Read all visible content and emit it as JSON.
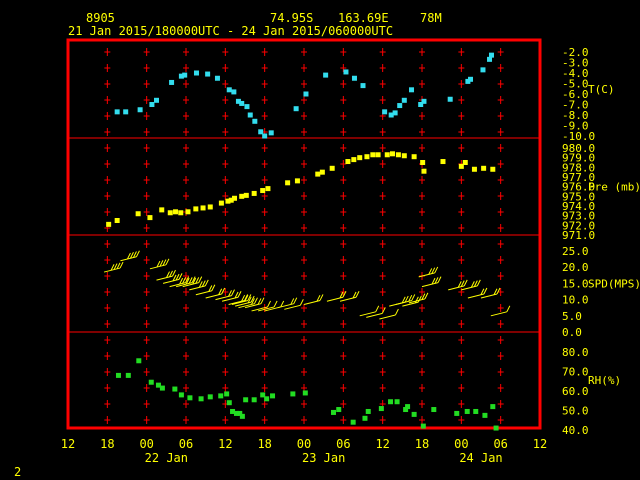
{
  "header": {
    "station": "8905",
    "lat": "74.95S",
    "lon": "163.69E",
    "elev": "78M",
    "period": "21 Jan 2015/180000UTC - 24 Jan 2015/060000UTC"
  },
  "page_number": "2",
  "colors": {
    "frame": "#ff0000",
    "grid_marks": "#ff0000",
    "text": "#ffff00",
    "temperature": "#33ddee",
    "pressure": "#ffff00",
    "wind": "#ffff00",
    "humidity": "#22dd22"
  },
  "chart_data": {
    "type": "scatter",
    "title": "",
    "time_axis": {
      "unit": "hours since 21 Jan 2015 00 UTC",
      "range": [
        12,
        84
      ],
      "ticks": [
        {
          "hour": 12,
          "label": "12"
        },
        {
          "hour": 18,
          "label": "18"
        },
        {
          "hour": 24,
          "label": "00"
        },
        {
          "hour": 30,
          "label": "06"
        },
        {
          "hour": 36,
          "label": "12"
        },
        {
          "hour": 42,
          "label": "18"
        },
        {
          "hour": 48,
          "label": "00"
        },
        {
          "hour": 54,
          "label": "06"
        },
        {
          "hour": 60,
          "label": "12"
        },
        {
          "hour": 66,
          "label": "18"
        },
        {
          "hour": 72,
          "label": "00"
        },
        {
          "hour": 78,
          "label": "06"
        },
        {
          "hour": 84,
          "label": "12"
        }
      ],
      "day_labels": [
        {
          "hour": 27,
          "label": "22 Jan"
        },
        {
          "hour": 51,
          "label": "23 Jan"
        },
        {
          "hour": 75,
          "label": "24 Jan"
        }
      ]
    },
    "panels": [
      {
        "id": "temperature",
        "label": "T(C)",
        "ylim": [
          -10.0,
          -2.0
        ],
        "ticks": [
          "-2.0",
          "-3.0",
          "-4.0",
          "-5.0",
          "-6.0",
          "-7.0",
          "-8.0",
          "-9.0",
          "-10.0"
        ],
        "tick_values": [
          -2,
          -3,
          -4,
          -5,
          -6,
          -7,
          -8,
          -9,
          -10
        ],
        "points": [
          [
            19.5,
            -7.7
          ],
          [
            20.8,
            -7.7
          ],
          [
            23,
            -7.5
          ],
          [
            24.8,
            -7.0
          ],
          [
            25.5,
            -6.6
          ],
          [
            27.8,
            -4.9
          ],
          [
            29.3,
            -4.3
          ],
          [
            29.8,
            -4.2
          ],
          [
            31.6,
            -4.0
          ],
          [
            33.3,
            -4.1
          ],
          [
            34.8,
            -4.5
          ],
          [
            36.6,
            -5.6
          ],
          [
            37.3,
            -5.8
          ],
          [
            38,
            -6.7
          ],
          [
            38.5,
            -6.9
          ],
          [
            39.3,
            -7.2
          ],
          [
            39.8,
            -8.0
          ],
          [
            40.5,
            -8.6
          ],
          [
            41.4,
            -9.6
          ],
          [
            42,
            -10.0
          ],
          [
            43,
            -9.7
          ],
          [
            46.8,
            -7.4
          ],
          [
            48.3,
            -6.0
          ],
          [
            51.3,
            -4.2
          ],
          [
            54.4,
            -3.9
          ],
          [
            55.7,
            -4.5
          ],
          [
            57,
            -5.2
          ],
          [
            60.3,
            -7.7
          ],
          [
            61.3,
            -8.0
          ],
          [
            61.9,
            -7.8
          ],
          [
            62.6,
            -7.1
          ],
          [
            63.3,
            -6.6
          ],
          [
            64.4,
            -5.6
          ],
          [
            65.8,
            -7.0
          ],
          [
            66.3,
            -6.7
          ],
          [
            70.3,
            -6.5
          ],
          [
            73,
            -4.8
          ],
          [
            73.4,
            -4.6
          ],
          [
            75.3,
            -3.7
          ],
          [
            76.3,
            -2.7
          ],
          [
            76.6,
            -2.3
          ]
        ]
      },
      {
        "id": "pressure",
        "label": "Pre (mb)",
        "ylim": [
          971.0,
          980.0
        ],
        "ticks": [
          "980.0",
          "979.0",
          "978.0",
          "977.0",
          "976.0",
          "975.0",
          "974.0",
          "973.0",
          "972.0",
          "971.0"
        ],
        "tick_values": [
          980,
          979,
          978,
          977,
          976,
          975,
          974,
          973,
          972,
          971
        ],
        "points": [
          [
            18.2,
            972.1
          ],
          [
            19.5,
            972.5
          ],
          [
            22.7,
            973.2
          ],
          [
            24.5,
            972.8
          ],
          [
            26.3,
            973.6
          ],
          [
            27.6,
            973.3
          ],
          [
            28.4,
            973.4
          ],
          [
            29.2,
            973.3
          ],
          [
            30.3,
            973.4
          ],
          [
            31.5,
            973.7
          ],
          [
            32.6,
            973.8
          ],
          [
            33.7,
            973.9
          ],
          [
            35.4,
            974.3
          ],
          [
            36.4,
            974.5
          ],
          [
            36.9,
            974.6
          ],
          [
            37.4,
            974.8
          ],
          [
            38.5,
            975.0
          ],
          [
            39.2,
            975.1
          ],
          [
            40.4,
            975.3
          ],
          [
            41.7,
            975.6
          ],
          [
            42.5,
            975.8
          ],
          [
            45.5,
            976.4
          ],
          [
            47,
            976.6
          ],
          [
            50.1,
            977.3
          ],
          [
            50.8,
            977.5
          ],
          [
            52.3,
            977.9
          ],
          [
            54.7,
            978.6
          ],
          [
            55.6,
            978.8
          ],
          [
            56.5,
            979.0
          ],
          [
            57.6,
            979.1
          ],
          [
            58.5,
            979.3
          ],
          [
            59.3,
            979.3
          ],
          [
            60.7,
            979.3
          ],
          [
            61.5,
            979.4
          ],
          [
            62.4,
            979.3
          ],
          [
            63.3,
            979.2
          ],
          [
            64.8,
            979.1
          ],
          [
            66.1,
            978.5
          ],
          [
            66.3,
            977.6
          ],
          [
            69.2,
            978.6
          ],
          [
            72,
            978.1
          ],
          [
            72.6,
            978.5
          ],
          [
            74,
            977.8
          ],
          [
            75.4,
            977.9
          ],
          [
            76.8,
            977.8
          ]
        ]
      },
      {
        "id": "wind",
        "label": "SPD(MPS)",
        "ylim": [
          0.0,
          25.0
        ],
        "ticks": [
          "25.0",
          "20.0",
          "15.0",
          "10.0",
          "5.0",
          "0.0"
        ],
        "tick_values": [
          25,
          20,
          15,
          10,
          5,
          0
        ],
        "barbs": [
          [
            17.5,
            18.5
          ],
          [
            20,
            22
          ],
          [
            24.5,
            19.5
          ],
          [
            25.5,
            16
          ],
          [
            26.5,
            15
          ],
          [
            27.5,
            14
          ],
          [
            28.5,
            14
          ],
          [
            29.5,
            14
          ],
          [
            30.5,
            13
          ],
          [
            31.5,
            11.5
          ],
          [
            33,
            10.5
          ],
          [
            34.5,
            10
          ],
          [
            35.5,
            9.5
          ],
          [
            36.5,
            8.5
          ],
          [
            37,
            8.5
          ],
          [
            37.5,
            8
          ],
          [
            38,
            7.5
          ],
          [
            39,
            7.5
          ],
          [
            40,
            6.5
          ],
          [
            41,
            6.5
          ],
          [
            42,
            6.5
          ],
          [
            44,
            7.5
          ],
          [
            45,
            7
          ],
          [
            48,
            8.5
          ],
          [
            51.5,
            9.5
          ],
          [
            53.5,
            9.5
          ],
          [
            56.5,
            5
          ],
          [
            57.5,
            4.5
          ],
          [
            59.5,
            4
          ],
          [
            61,
            8
          ],
          [
            62,
            8.5
          ],
          [
            63,
            8
          ],
          [
            64,
            9
          ],
          [
            66,
            14
          ],
          [
            65.5,
            17
          ],
          [
            70,
            13
          ],
          [
            72,
            13
          ],
          [
            73,
            10.5
          ],
          [
            75,
            10.5
          ],
          [
            76.5,
            5
          ]
        ]
      },
      {
        "id": "humidity",
        "label": "RH(%)",
        "ylim": [
          40.0,
          80.0
        ],
        "ticks": [
          "80.0",
          "70.0",
          "60.0",
          "50.0",
          "40.0"
        ],
        "tick_values": [
          80,
          70,
          60,
          50,
          40
        ],
        "points": [
          [
            19.7,
            68
          ],
          [
            21.2,
            68
          ],
          [
            22.8,
            75.5
          ],
          [
            24.7,
            64.5
          ],
          [
            25.8,
            63
          ],
          [
            26.4,
            61.5
          ],
          [
            28.3,
            61
          ],
          [
            29.3,
            58
          ],
          [
            30.6,
            56.5
          ],
          [
            32.3,
            56
          ],
          [
            33.7,
            57
          ],
          [
            35.3,
            57.5
          ],
          [
            36.2,
            58.5
          ],
          [
            36.6,
            54
          ],
          [
            37.1,
            49.5
          ],
          [
            37.7,
            48.5
          ],
          [
            38.2,
            48.5
          ],
          [
            38.6,
            47
          ],
          [
            39.1,
            55.5
          ],
          [
            40.4,
            55.5
          ],
          [
            41.7,
            58
          ],
          [
            42.3,
            56
          ],
          [
            43.2,
            57.5
          ],
          [
            46.3,
            58.5
          ],
          [
            48.2,
            59
          ],
          [
            52.5,
            49
          ],
          [
            53.3,
            50.5
          ],
          [
            55.5,
            44
          ],
          [
            57.3,
            46
          ],
          [
            57.8,
            49.5
          ],
          [
            59.8,
            51
          ],
          [
            61.2,
            54.5
          ],
          [
            62.2,
            54.5
          ],
          [
            63.5,
            50.5
          ],
          [
            63.8,
            52
          ],
          [
            64.8,
            48
          ],
          [
            66.2,
            42
          ],
          [
            67.8,
            50.5
          ],
          [
            71.3,
            48.5
          ],
          [
            72.9,
            49.5
          ],
          [
            74.2,
            49.5
          ],
          [
            75.6,
            47.5
          ],
          [
            76.8,
            52
          ],
          [
            77.3,
            41
          ]
        ]
      }
    ]
  }
}
